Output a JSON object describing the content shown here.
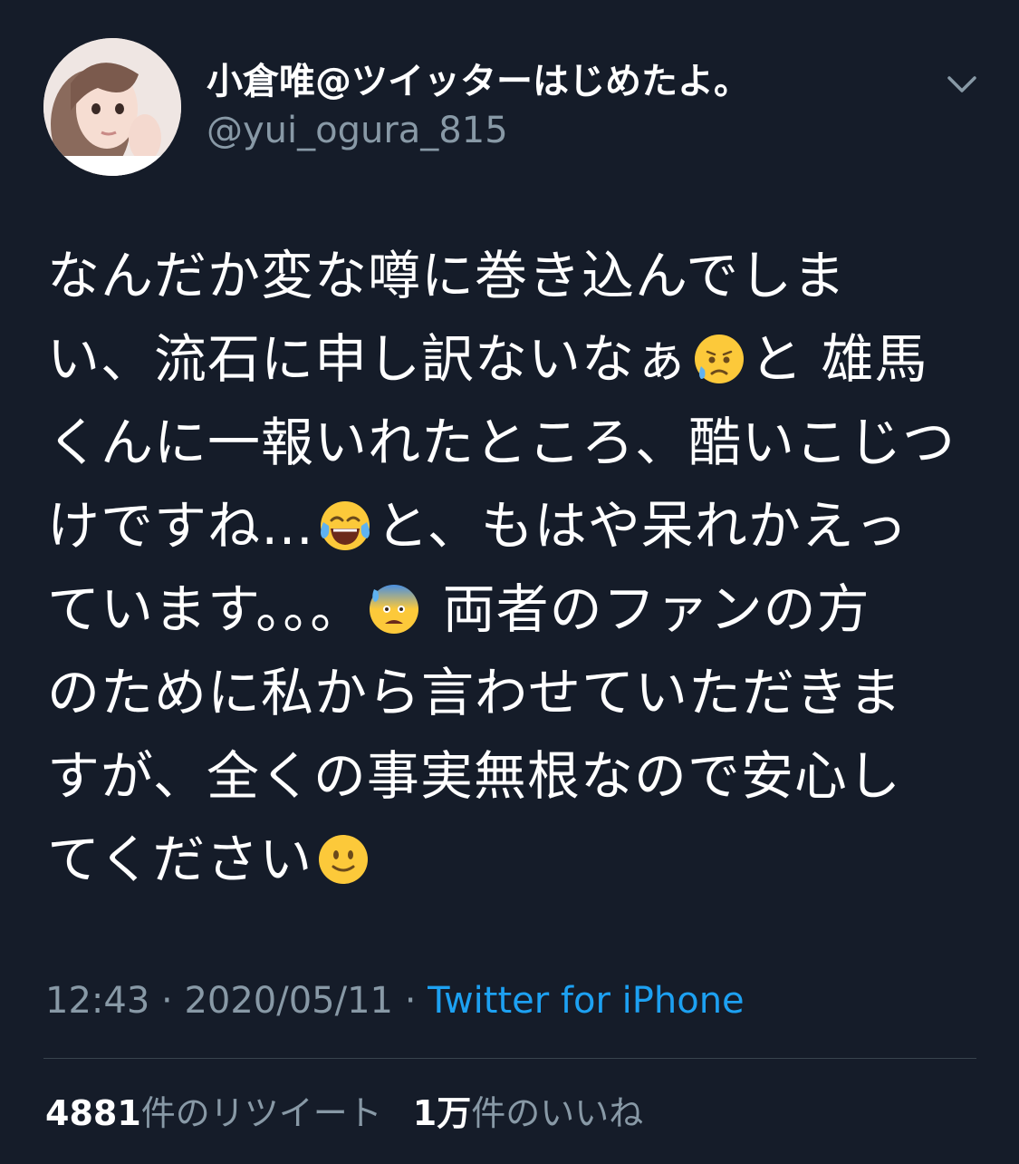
{
  "author": {
    "display_name": "小倉唯@ツイッターはじめたよ。",
    "handle": "@yui_ogura_815",
    "avatar_icon": "profile-photo",
    "menu_icon": "chevron-down-icon"
  },
  "tweet": {
    "lines": [
      {
        "text": "なんだか変な噂に巻き込んでしま"
      },
      {
        "text": "い、流石に申し訳ないなぁ",
        "emoji": "disappointed-relieved-face",
        "after": "と 雄馬"
      },
      {
        "text": "くんに一報いれたところ、酷いこじつ"
      },
      {
        "text": "けですね…",
        "emoji": "face-with-tears-of-joy",
        "after": "と、もはや呆れかえっ"
      },
      {
        "text": "ています。。。",
        "emoji": "anxious-face-with-sweat",
        "after": " 両者のファンの方"
      },
      {
        "text": "のために私から言わせていただきま"
      },
      {
        "text": "すが、全くの事実無根なので安心し"
      },
      {
        "text": "てください",
        "emoji": "slightly-smiling-face",
        "after": ""
      }
    ]
  },
  "meta": {
    "time": "12:43",
    "sep1": " · ",
    "date": "2020/05/11",
    "sep2": " · ",
    "source": "Twitter for iPhone"
  },
  "stats": {
    "retweet_count": "4881",
    "retweet_label": "件のリツイート",
    "like_count": "1万",
    "like_label": "件のいいね"
  },
  "colors": {
    "background": "#151c29",
    "secondary_text": "#8899a6",
    "link": "#1da1f2",
    "divider": "#38444d"
  }
}
